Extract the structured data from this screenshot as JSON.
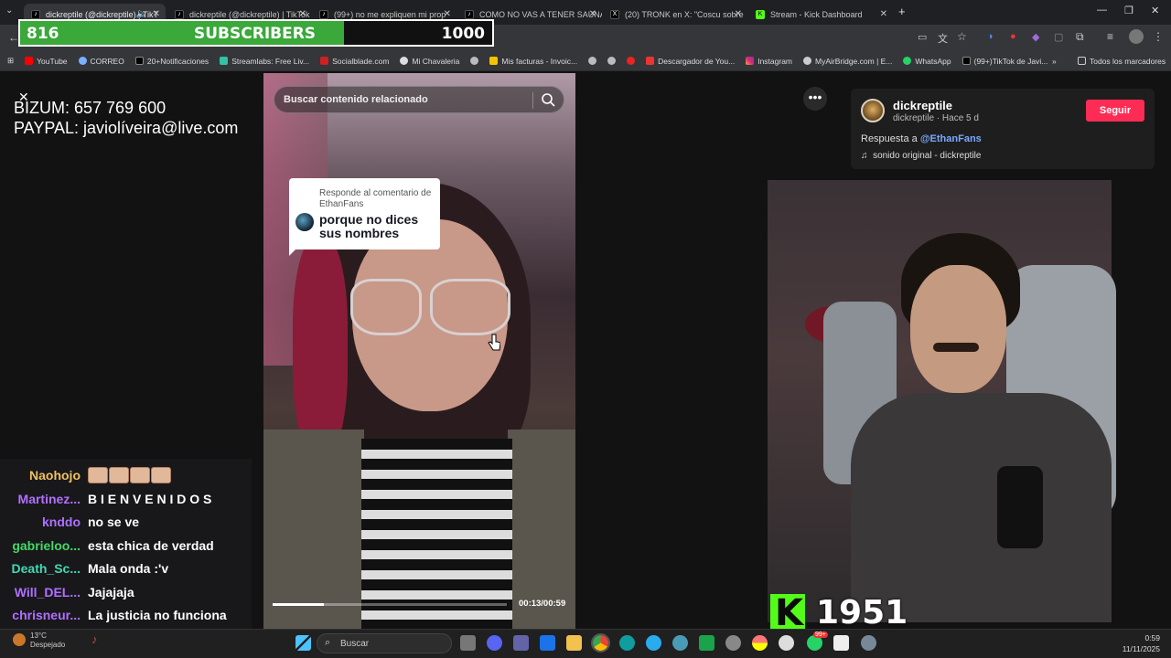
{
  "browser": {
    "tabs": [
      {
        "title": "dickreptile (@dickreptile) | TikT",
        "active": true
      },
      {
        "title": "dickreptile (@dickreptile) | TikTok"
      },
      {
        "title": "(99+) no me expliquen mi prop"
      },
      {
        "title": "COMO NO VAS A TENER SAUNA"
      },
      {
        "title": "(20) TRONK en X: \"Coscu sobre"
      },
      {
        "title": "Stream - Kick Dashboard"
      }
    ],
    "new_tab": "+",
    "bookmarks": [
      "YouTube",
      "CORREO",
      "20+Notificaciones",
      "Streamlabs: Free Liv...",
      "Socialblade.com",
      "Mi Chavaleria",
      "Mis facturas - Invoic...",
      "Descargador de You...",
      "Instagram",
      "MyAirBridge.com | E...",
      "WhatsApp",
      "(99+)TikTok de Javi..."
    ],
    "all_bookmarks": "Todos los marcadores"
  },
  "subs": {
    "current": "816",
    "label": "SUBSCRIBERS",
    "goal": "1000",
    "progress": 0.816
  },
  "donate": {
    "bizum": "BIZUM: 657 769 600",
    "paypal": "PAYPAL: javiolíveira@live.com"
  },
  "video": {
    "search_placeholder": "Buscar contenido relacionado",
    "comment_header": "Responde al comentario de EthanFans",
    "comment_text": "porque no dices sus nombres",
    "time": "00:13/00:59",
    "progress": 0.22
  },
  "post": {
    "username": "dickreptile",
    "meta": "dickreptile · Hace 5 d",
    "follow": "Seguir",
    "reply_prefix": "Respuesta a ",
    "reply_mention": "@EthanFans",
    "sound": "sonido original - dickreptile"
  },
  "kick": {
    "viewers": "1951"
  },
  "chat": [
    {
      "user": "Naohojo",
      "color": "#f0c060",
      "msg": "",
      "emotes": 4
    },
    {
      "user": "Martinez...",
      "color": "#b070ff",
      "msg": "B I E N V E N I D O S"
    },
    {
      "user": "knddo",
      "color": "#b070ff",
      "msg": "no se ve"
    },
    {
      "user": "gabrieloo...",
      "color": "#45d868",
      "msg": "esta chica de verdad"
    },
    {
      "user": "Death_Sc...",
      "color": "#45d8b0",
      "msg": "Mala onda :'v"
    },
    {
      "user": "Will_DEL...",
      "color": "#b070ff",
      "msg": "Jajajaja"
    },
    {
      "user": "chrisneur...",
      "color": "#b070ff",
      "msg": "La justicia no funciona"
    }
  ],
  "taskbar": {
    "weather_temp": "13°C",
    "weather_desc": "Despejado",
    "search": "Buscar",
    "time": "0:59",
    "date": "11/11/2025",
    "badge": "99+"
  },
  "colors": {
    "kick_green": "#53fc18",
    "tiktok_red": "#fe2c55",
    "subs_green": "#3aa83a"
  }
}
